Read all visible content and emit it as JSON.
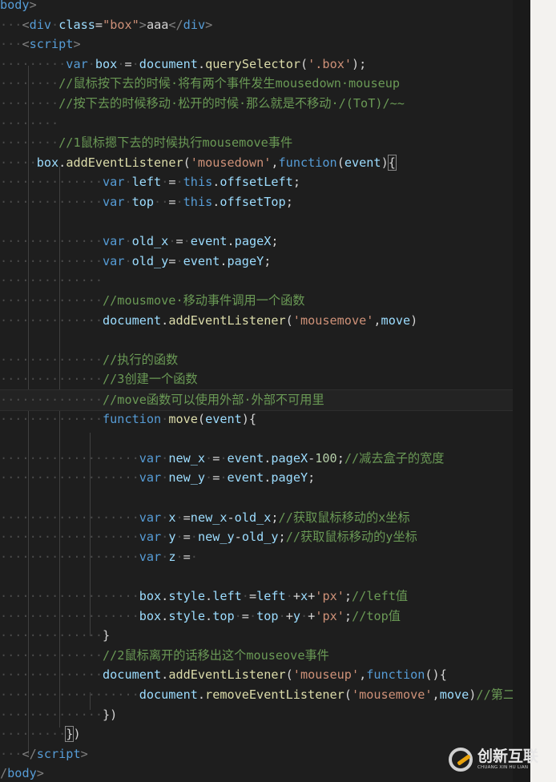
{
  "editor": {
    "lines": [
      {
        "indent": "",
        "tokens": [
          [
            "tag",
            "body"
          ],
          [
            "pun",
            ">"
          ]
        ]
      },
      {
        "indent": "···",
        "tokens": [
          [
            "pun",
            "<"
          ],
          [
            "tag",
            "div"
          ],
          [
            "ws",
            "·"
          ],
          [
            "attr",
            "class"
          ],
          [
            "op",
            "="
          ],
          [
            "str",
            "\"box\""
          ],
          [
            "pun",
            ">"
          ],
          [
            "op",
            "aaa"
          ],
          [
            "pun",
            "</"
          ],
          [
            "tag",
            "div"
          ],
          [
            "pun",
            ">"
          ]
        ]
      },
      {
        "indent": "···",
        "tokens": [
          [
            "pun",
            "<"
          ],
          [
            "tag",
            "script"
          ],
          [
            "pun",
            ">"
          ]
        ]
      },
      {
        "indent": "·········",
        "tokens": [
          [
            "kw",
            "var"
          ],
          [
            "ws",
            "·"
          ],
          [
            "var",
            "box"
          ],
          [
            "ws",
            "·"
          ],
          [
            "op",
            "="
          ],
          [
            "ws",
            "·"
          ],
          [
            "var",
            "document"
          ],
          [
            "op",
            "."
          ],
          [
            "fn",
            "querySelector"
          ],
          [
            "op",
            "("
          ],
          [
            "str",
            "'.box'"
          ],
          [
            "op",
            ");"
          ]
        ]
      },
      {
        "indent": "········",
        "tokens": [
          [
            "cmt",
            "//鼠标按下去的时候·将有两个事件发生mousedown·mouseup"
          ]
        ]
      },
      {
        "indent": "········",
        "tokens": [
          [
            "cmt",
            "//按下去的时候移动·松开的时候·那么就是不移动·/(ToT)/~~"
          ]
        ]
      },
      {
        "indent": "········",
        "tokens": []
      },
      {
        "indent": "········",
        "tokens": [
          [
            "cmt",
            "//1鼠标摁下去的时候执行mousemove事件"
          ]
        ]
      },
      {
        "indent": "·····",
        "tokens": [
          [
            "var",
            "box"
          ],
          [
            "op",
            "."
          ],
          [
            "fn",
            "addEventListener"
          ],
          [
            "op",
            "("
          ],
          [
            "str",
            "'mousedown'"
          ],
          [
            "op",
            ","
          ],
          [
            "kw",
            "function"
          ],
          [
            "op",
            "("
          ],
          [
            "var",
            "event"
          ],
          [
            "op",
            ")"
          ],
          [
            "match",
            "{"
          ]
        ]
      },
      {
        "indent": "··············",
        "tokens": [
          [
            "kw",
            "var"
          ],
          [
            "ws",
            "·"
          ],
          [
            "var",
            "left"
          ],
          [
            "ws",
            "·"
          ],
          [
            "op",
            "="
          ],
          [
            "ws",
            "·"
          ],
          [
            "kw",
            "this"
          ],
          [
            "op",
            "."
          ],
          [
            "var",
            "offsetLeft"
          ],
          [
            "op",
            ";"
          ]
        ]
      },
      {
        "indent": "··············",
        "tokens": [
          [
            "kw",
            "var"
          ],
          [
            "ws",
            "·"
          ],
          [
            "var",
            "top"
          ],
          [
            "ws",
            "··"
          ],
          [
            "op",
            "="
          ],
          [
            "ws",
            "·"
          ],
          [
            "kw",
            "this"
          ],
          [
            "op",
            "."
          ],
          [
            "var",
            "offsetTop"
          ],
          [
            "op",
            ";"
          ]
        ]
      },
      {
        "indent": "",
        "tokens": []
      },
      {
        "indent": "··············",
        "tokens": [
          [
            "kw",
            "var"
          ],
          [
            "ws",
            "·"
          ],
          [
            "var",
            "old_x"
          ],
          [
            "ws",
            "·"
          ],
          [
            "op",
            "="
          ],
          [
            "ws",
            "·"
          ],
          [
            "var",
            "event"
          ],
          [
            "op",
            "."
          ],
          [
            "var",
            "pageX"
          ],
          [
            "op",
            ";"
          ]
        ]
      },
      {
        "indent": "··············",
        "tokens": [
          [
            "kw",
            "var"
          ],
          [
            "ws",
            "·"
          ],
          [
            "var",
            "old_y"
          ],
          [
            "op",
            "="
          ],
          [
            "ws",
            "·"
          ],
          [
            "var",
            "event"
          ],
          [
            "op",
            "."
          ],
          [
            "var",
            "pageY"
          ],
          [
            "op",
            ";"
          ]
        ]
      },
      {
        "indent": "··············",
        "tokens": []
      },
      {
        "indent": "··············",
        "tokens": [
          [
            "cmt",
            "//mousmove·移动事件调用一个函数"
          ]
        ]
      },
      {
        "indent": "··············",
        "tokens": [
          [
            "var",
            "document"
          ],
          [
            "op",
            "."
          ],
          [
            "fn",
            "addEventListener"
          ],
          [
            "op",
            "("
          ],
          [
            "str",
            "'mousemove'"
          ],
          [
            "op",
            ","
          ],
          [
            "var",
            "move"
          ],
          [
            "op",
            ")"
          ]
        ]
      },
      {
        "indent": "",
        "tokens": []
      },
      {
        "indent": "··············",
        "tokens": [
          [
            "cmt",
            "//执行的函数"
          ]
        ]
      },
      {
        "indent": "··············",
        "tokens": [
          [
            "cmt",
            "//3创建一个函数"
          ]
        ]
      },
      {
        "indent": "··············",
        "tokens": [
          [
            "cmt",
            "//move函数可以使用外部·外部不可用里"
          ]
        ],
        "highlight": true
      },
      {
        "indent": "··············",
        "tokens": [
          [
            "kw",
            "function"
          ],
          [
            "ws",
            "·"
          ],
          [
            "fn",
            "move"
          ],
          [
            "op",
            "("
          ],
          [
            "var",
            "event"
          ],
          [
            "op",
            "){"
          ]
        ]
      },
      {
        "indent": "",
        "tokens": []
      },
      {
        "indent": "···················",
        "tokens": [
          [
            "kw",
            "var"
          ],
          [
            "ws",
            "·"
          ],
          [
            "var",
            "new_x"
          ],
          [
            "ws",
            "·"
          ],
          [
            "op",
            "="
          ],
          [
            "ws",
            "·"
          ],
          [
            "var",
            "event"
          ],
          [
            "op",
            "."
          ],
          [
            "var",
            "pageX"
          ],
          [
            "op",
            "-"
          ],
          [
            "num",
            "100"
          ],
          [
            "op",
            ";"
          ],
          [
            "cmt",
            "//减去盒子的宽度"
          ]
        ]
      },
      {
        "indent": "···················",
        "tokens": [
          [
            "kw",
            "var"
          ],
          [
            "ws",
            "·"
          ],
          [
            "var",
            "new_y"
          ],
          [
            "ws",
            "·"
          ],
          [
            "op",
            "="
          ],
          [
            "ws",
            "·"
          ],
          [
            "var",
            "event"
          ],
          [
            "op",
            "."
          ],
          [
            "var",
            "pageY"
          ],
          [
            "op",
            ";"
          ]
        ]
      },
      {
        "indent": "",
        "tokens": []
      },
      {
        "indent": "···················",
        "tokens": [
          [
            "kw",
            "var"
          ],
          [
            "ws",
            "·"
          ],
          [
            "var",
            "x"
          ],
          [
            "ws",
            "·"
          ],
          [
            "op",
            "="
          ],
          [
            "var",
            "new_x"
          ],
          [
            "op",
            "-"
          ],
          [
            "var",
            "old_x"
          ],
          [
            "op",
            ";"
          ],
          [
            "cmt",
            "//获取鼠标移动的x坐标"
          ]
        ]
      },
      {
        "indent": "···················",
        "tokens": [
          [
            "kw",
            "var"
          ],
          [
            "ws",
            "·"
          ],
          [
            "var",
            "y"
          ],
          [
            "ws",
            "·"
          ],
          [
            "op",
            "="
          ],
          [
            "ws",
            "·"
          ],
          [
            "var",
            "new_y"
          ],
          [
            "op",
            "-"
          ],
          [
            "var",
            "old_y"
          ],
          [
            "op",
            ";"
          ],
          [
            "cmt",
            "//获取鼠标移动的y坐标"
          ]
        ]
      },
      {
        "indent": "···················",
        "tokens": [
          [
            "kw",
            "var"
          ],
          [
            "ws",
            "·"
          ],
          [
            "var",
            "z"
          ],
          [
            "ws",
            "·"
          ],
          [
            "op",
            "="
          ],
          [
            "ws",
            "·"
          ]
        ]
      },
      {
        "indent": "",
        "tokens": []
      },
      {
        "indent": "···················",
        "tokens": [
          [
            "var",
            "box"
          ],
          [
            "op",
            "."
          ],
          [
            "var",
            "style"
          ],
          [
            "op",
            "."
          ],
          [
            "var",
            "left"
          ],
          [
            "ws",
            "·"
          ],
          [
            "op",
            "="
          ],
          [
            "var",
            "left"
          ],
          [
            "ws",
            "·"
          ],
          [
            "op",
            "+"
          ],
          [
            "var",
            "x"
          ],
          [
            "op",
            "+"
          ],
          [
            "str",
            "'px'"
          ],
          [
            "op",
            ";"
          ],
          [
            "cmt",
            "//left值"
          ]
        ]
      },
      {
        "indent": "···················",
        "tokens": [
          [
            "var",
            "box"
          ],
          [
            "op",
            "."
          ],
          [
            "var",
            "style"
          ],
          [
            "op",
            "."
          ],
          [
            "var",
            "top"
          ],
          [
            "ws",
            "·"
          ],
          [
            "op",
            "="
          ],
          [
            "ws",
            "·"
          ],
          [
            "var",
            "top"
          ],
          [
            "ws",
            "·"
          ],
          [
            "op",
            "+"
          ],
          [
            "var",
            "y"
          ],
          [
            "ws",
            "·"
          ],
          [
            "op",
            "+"
          ],
          [
            "str",
            "'px'"
          ],
          [
            "op",
            ";"
          ],
          [
            "cmt",
            "//top值"
          ]
        ]
      },
      {
        "indent": "··············",
        "tokens": [
          [
            "brace",
            "}"
          ]
        ]
      },
      {
        "indent": "··············",
        "tokens": [
          [
            "cmt",
            "//2鼠标离开的话移出这个mouseove事件"
          ]
        ]
      },
      {
        "indent": "··············",
        "tokens": [
          [
            "var",
            "document"
          ],
          [
            "op",
            "."
          ],
          [
            "fn",
            "addEventListener"
          ],
          [
            "op",
            "("
          ],
          [
            "str",
            "'mouseup'"
          ],
          [
            "op",
            ","
          ],
          [
            "kw",
            "function"
          ],
          [
            "op",
            "(){"
          ]
        ]
      },
      {
        "indent": "···················",
        "tokens": [
          [
            "var",
            "document"
          ],
          [
            "op",
            "."
          ],
          [
            "fn",
            "removeEventListener"
          ],
          [
            "op",
            "("
          ],
          [
            "str",
            "'mousemove'"
          ],
          [
            "op",
            ","
          ],
          [
            "var",
            "move"
          ],
          [
            "op",
            ")"
          ],
          [
            "cmt",
            "//第二"
          ]
        ]
      },
      {
        "indent": "··············",
        "tokens": [
          [
            "op",
            "})"
          ]
        ]
      },
      {
        "indent": "·········",
        "tokens": [
          [
            "match",
            "}"
          ],
          [
            "op",
            ")"
          ]
        ]
      },
      {
        "indent": "···",
        "tokens": [
          [
            "pun",
            "</"
          ],
          [
            "tag",
            "script"
          ],
          [
            "pun",
            ">"
          ]
        ]
      },
      {
        "indent": "",
        "tokens": [
          [
            "pun",
            "/"
          ],
          [
            "tag",
            "body"
          ],
          [
            "pun",
            ">"
          ]
        ]
      }
    ]
  },
  "watermark": {
    "name_cn": "创新互联",
    "name_en": "CHUANG XIN HU LIAN"
  }
}
